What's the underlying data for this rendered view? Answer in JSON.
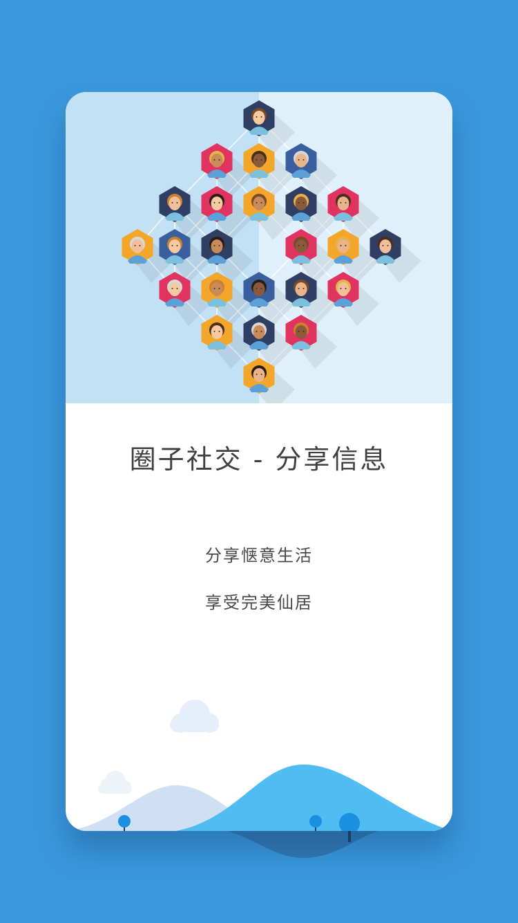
{
  "onboarding": {
    "title": "圈子社交 - 分享信息",
    "subtitle_line1": "分享惬意生活",
    "subtitle_line2": "享受完美仙居"
  },
  "colors": {
    "background": "#3b97dc",
    "hero_left": "#c3e1f5",
    "hero_right": "#dff0fa",
    "hill_front": "#4fbdf2",
    "hill_back": "#cfe0f5",
    "tree": "#1b8fe0"
  },
  "icons": [
    "avatar-icon",
    "cloud-icon",
    "tree-icon",
    "hill-icon"
  ]
}
